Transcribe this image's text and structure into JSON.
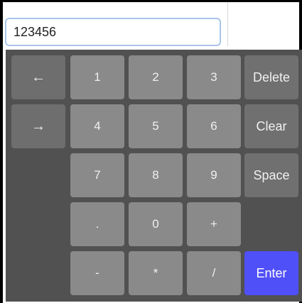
{
  "input": {
    "value": "123456"
  },
  "keyboard": {
    "left_arrow": "←",
    "right_arrow": "→",
    "digits": [
      "1",
      "2",
      "3",
      "4",
      "5",
      "6",
      "7",
      "8",
      "9",
      "0"
    ],
    "dot": ".",
    "plus": "+",
    "minus": "-",
    "star": "*",
    "slash": "/",
    "delete_label": "Delete",
    "clear_label": "Clear",
    "space_label": "Space",
    "enter_label": "Enter"
  },
  "colors": {
    "keyboard_bg": "#515151",
    "key_bg": "#8a8a8a",
    "dark_key_bg": "#6e6e6e",
    "enter_bg": "#5050f8",
    "input_border": "#a9c4ea"
  }
}
